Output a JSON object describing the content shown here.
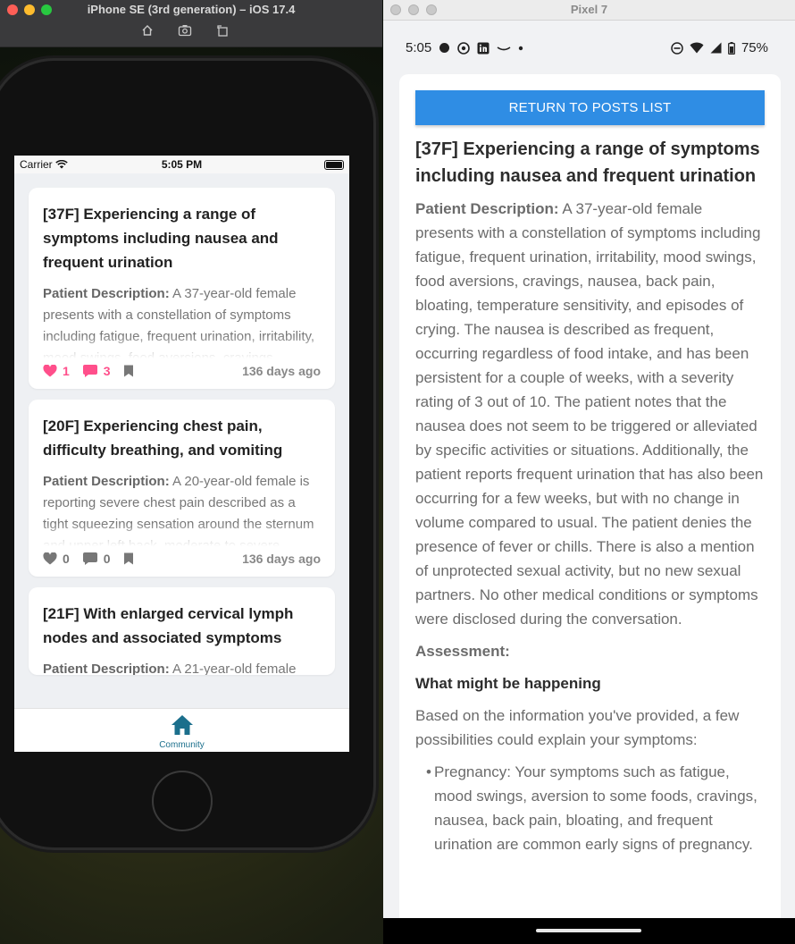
{
  "ios": {
    "window_title": "iPhone SE (3rd generation) – iOS 17.4",
    "status": {
      "carrier": "Carrier",
      "time": "5:05 PM"
    },
    "posts": [
      {
        "title": "[37F] Experiencing a range of symptoms including nausea and frequent urination",
        "desc_label": "Patient Description:",
        "desc_text": " A 37-year-old female presents with a constellation of symptoms including fatigue, frequent urination, irritability, mood swings, food aversions, cravings, nausea,",
        "likes": "1",
        "comments": "3",
        "age": "136 days ago"
      },
      {
        "title": "[20F] Experiencing chest pain, difficulty breathing, and vomiting",
        "desc_label": "Patient Description:",
        "desc_text": " A 20-year-old female is reporting severe chest pain described as a tight squeezing sensation around the sternum and upper left back, moderate to severe",
        "likes": "0",
        "comments": "0",
        "age": "136 days ago"
      },
      {
        "title": "[21F] With enlarged cervical lymph nodes and associated symptoms",
        "desc_label": "Patient Description:",
        "desc_text": " A 21-year-old female"
      }
    ],
    "tab_label": "Community"
  },
  "android": {
    "window_title": "Pixel 7",
    "status": {
      "time": "5:05",
      "battery": "75%"
    },
    "return_button": "RETURN TO POSTS LIST",
    "title": "[37F] Experiencing a range of symptoms including nausea and frequent urination",
    "desc_label": "Patient Description:",
    "desc_text": " A 37-year-old female presents with a constellation of symptoms including fatigue, frequent urination, irritability, mood swings, food aversions, cravings, nausea, back pain, bloating, temperature sensitivity, and episodes of crying. The nausea is described as frequent, occurring regardless of food intake, and has been persistent for a couple of weeks, with a severity rating of 3 out of 10. The patient notes that the nausea does not seem to be triggered or alleviated by specific activities or situations. Additionally, the patient reports frequent urination that has also been occurring for a few weeks, but with no change in volume compared to usual. The patient denies the presence of fever or chills. There is also a mention of unprotected sexual activity, but no new sexual partners. No other medical conditions or symptoms were disclosed during the conversation.",
    "assessment_label": "Assessment:",
    "section_heading": "What might be happening",
    "intro": "Based on the information you've provided, a few possibilities could explain your symptoms:",
    "bullet": "Pregnancy: Your symptoms such as fatigue, mood swings, aversion to some foods, cravings, nausea, back pain, bloating, and frequent urination are common early signs of pregnancy."
  },
  "colors": {
    "accent_blue": "#2f8de4",
    "like_pink": "#ff4f8b",
    "tab_teal": "#1b6f8c"
  },
  "icons": [
    "home-icon",
    "heart-icon",
    "comment-icon",
    "bookmark-icon",
    "wifi-icon",
    "battery-icon",
    "signal-icon",
    "dnd-icon"
  ]
}
